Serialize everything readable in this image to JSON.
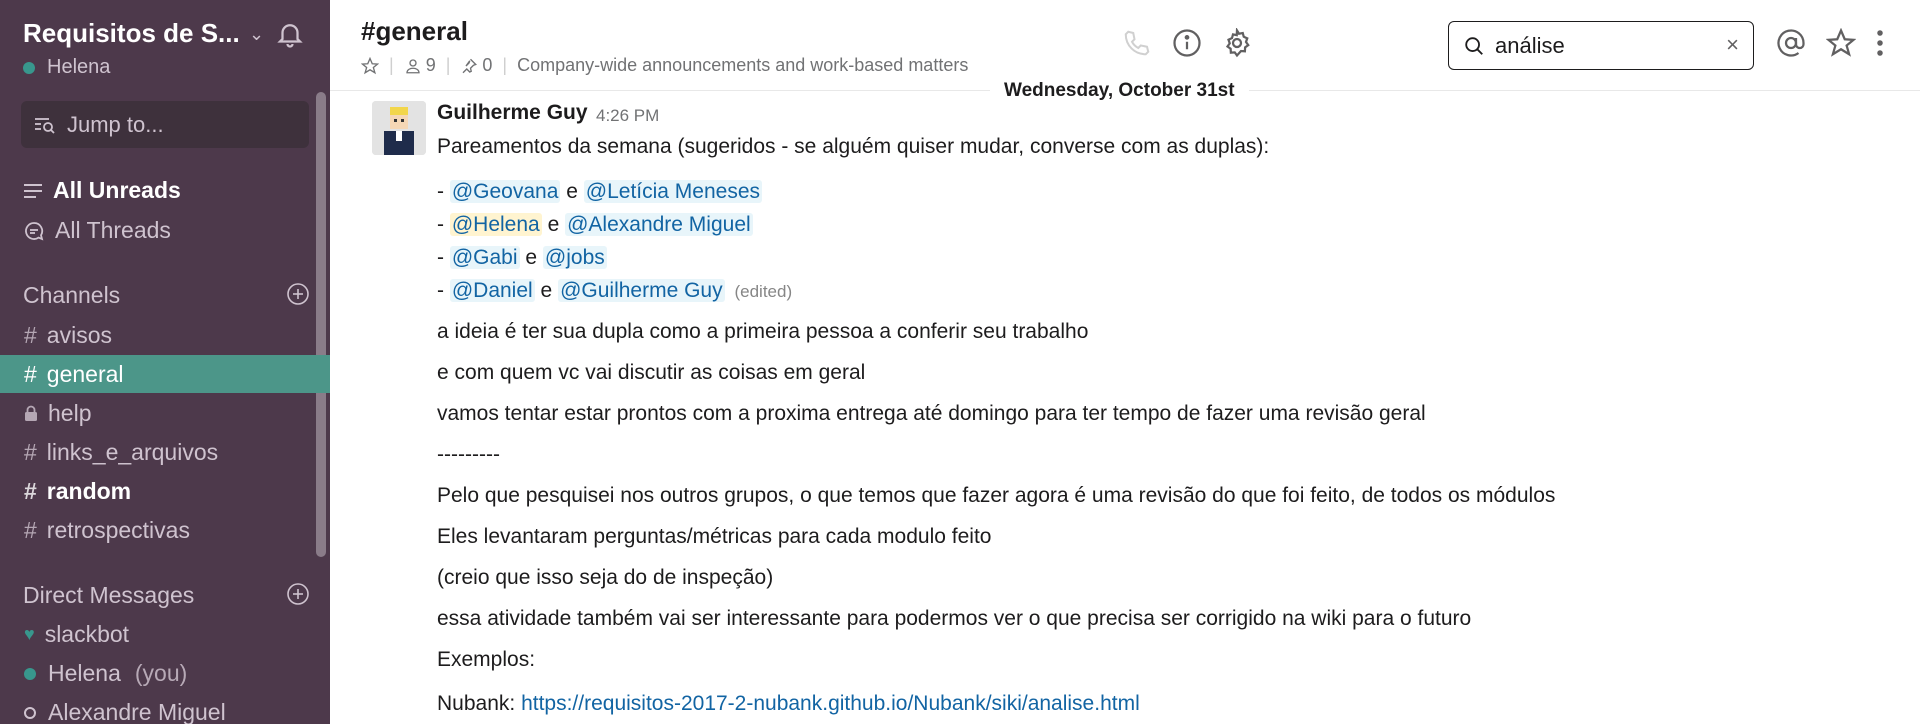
{
  "sidebar": {
    "team_name": "Requisitos de S...",
    "user_name": "Helena",
    "jump_to": "Jump to...",
    "nav": [
      {
        "label": "All Unreads"
      },
      {
        "label": "All Threads"
      }
    ],
    "channels_title": "Channels",
    "channels": [
      {
        "name": "avisos",
        "prefix": "#"
      },
      {
        "name": "general",
        "prefix": "#"
      },
      {
        "name": "help",
        "prefix": "lock"
      },
      {
        "name": "links_e_arquivos",
        "prefix": "#"
      },
      {
        "name": "random",
        "prefix": "#"
      },
      {
        "name": "retrospectivas",
        "prefix": "#"
      }
    ],
    "dm_title": "Direct Messages",
    "dms": [
      {
        "name": "slackbot"
      },
      {
        "name": "Helena",
        "suffix": "(you)"
      },
      {
        "name": "Alexandre Miguel"
      }
    ]
  },
  "header": {
    "channel": "#general",
    "members": "9",
    "pins": "0",
    "topic": "Company-wide announcements and work-based matters",
    "search_value": "análise",
    "search_clear": "×"
  },
  "date_divider": "Wednesday, October 31st",
  "message": {
    "author": "Guilherme Guy",
    "time": "4:26 PM",
    "intro": "Pareamentos da semana (sugeridos - se alguém quiser mudar, converse com as duplas):",
    "pairs": [
      {
        "a": "@Geovana",
        "b": "@Letícia Meneses"
      },
      {
        "a": "@Helena",
        "b": "@Alexandre Miguel"
      },
      {
        "a": "@Gabi",
        "b": "@jobs"
      },
      {
        "a": "@Daniel",
        "b": "@Guilherme Guy",
        "edited": "(edited)"
      }
    ],
    "dash": "-",
    "conj": "e",
    "lines": [
      "a ideia é ter sua dupla como a primeira pessoa a conferir seu trabalho",
      "e com quem vc vai discutir as coisas em geral",
      "vamos tentar estar prontos com a proxima entrega até domingo para ter tempo de fazer uma revisão geral",
      "---------",
      "Pelo que pesquisei nos outros grupos, o que temos que fazer agora é uma revisão do que foi feito, de todos os módulos",
      "Eles levantaram perguntas/métricas para cada modulo feito",
      "(creio que isso seja do de inspeção)",
      "essa atividade também vai ser interessante para podermos ver o que precisa ser corrigido na wiki para o futuro",
      "Exemplos:"
    ],
    "link_prefix": "Nubank:",
    "link_url": "https://requisitos-2017-2-nubank.github.io/Nubank/siki/analise.html"
  }
}
